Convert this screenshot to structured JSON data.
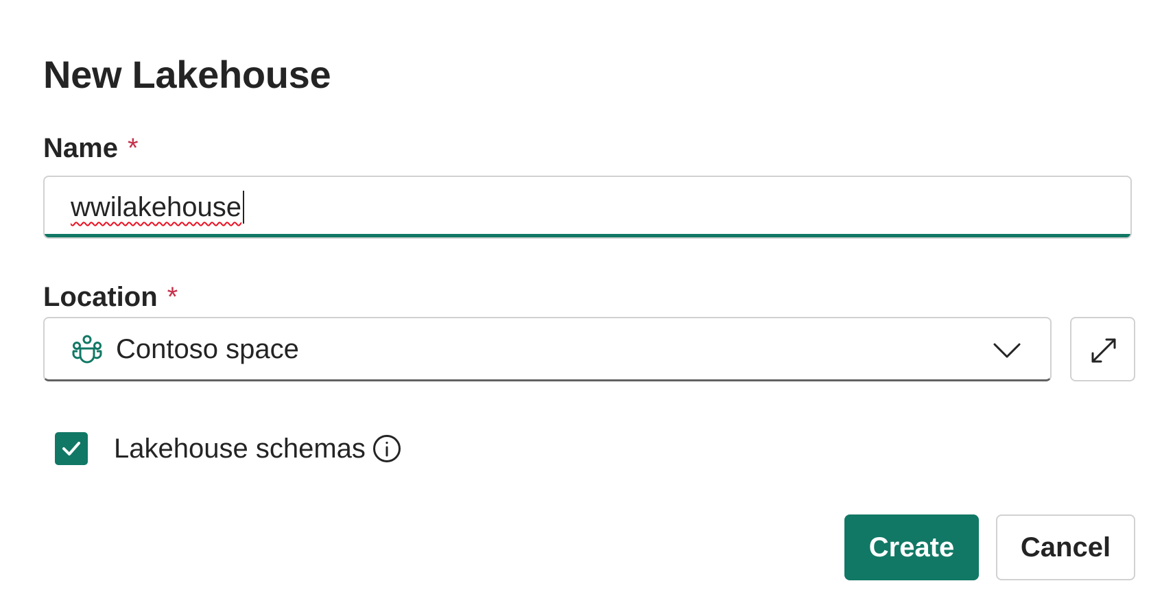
{
  "dialog": {
    "title": "New Lakehouse"
  },
  "name_field": {
    "label": "Name",
    "required_marker": "*",
    "value": "wwilakehouse",
    "spellcheck_error": true
  },
  "location_field": {
    "label": "Location",
    "required_marker": "*",
    "selected_value": "Contoso space",
    "icon": "workspace-people-icon",
    "dropdown_icon": "chevron-down-icon",
    "expand_icon": "expand-arrow-icon"
  },
  "schemas_option": {
    "label": "Lakehouse schemas",
    "checked": true,
    "info_icon": "info-icon"
  },
  "actions": {
    "create_label": "Create",
    "cancel_label": "Cancel"
  },
  "colors": {
    "accent": "#117865",
    "required": "#c4314b",
    "text": "#242424",
    "border": "#d1d1d1",
    "spellcheck": "#e81123"
  }
}
